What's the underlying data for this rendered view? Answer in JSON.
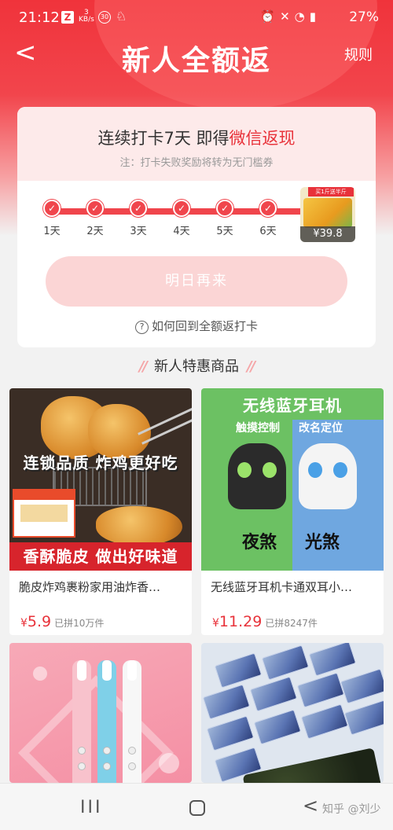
{
  "status_bar": {
    "time": "21:12",
    "net_speed_value": "3",
    "net_speed_unit": "KB/s",
    "notification_badge": "30",
    "battery": "27%"
  },
  "nav": {
    "back_glyph": "<",
    "title": "新人全额返",
    "rules_label": "规则"
  },
  "checkin": {
    "headline_prefix": "连续打卡7天 即得",
    "headline_highlight": "微信返现",
    "note": "注：打卡失败奖励将转为无门槛券",
    "days": [
      "1天",
      "2天",
      "3天",
      "4天",
      "5天",
      "6天"
    ],
    "prize_tag": "买1斤送半斤",
    "prize_price": "¥39.8",
    "action_button": "明日再来",
    "help_link": "如何回到全额返打卡",
    "accent_color": "#e8323a"
  },
  "section_title": "新人特惠商品",
  "products": [
    {
      "banner_top": "连锁品质 炸鸡更好吃",
      "banner_bottom": "香酥脆皮 做出好味道",
      "name": "脆皮炸鸡裹粉家用油炸香…",
      "price": "5.9",
      "sold": "已拼10万件"
    },
    {
      "banner_top": "无线蓝牙耳机",
      "feature_left": "触摸控制",
      "feature_right": "改名定位",
      "label_left": "夜煞",
      "label_right": "光煞",
      "name": "无线蓝牙耳机卡通双耳小…",
      "price": "11.29",
      "sold": "已拼8247件"
    },
    {},
    {}
  ],
  "currency_symbol": "¥",
  "system_nav": {
    "recent_glyph": "III",
    "back_glyph": "<",
    "watermark": "知乎 @刘少"
  }
}
